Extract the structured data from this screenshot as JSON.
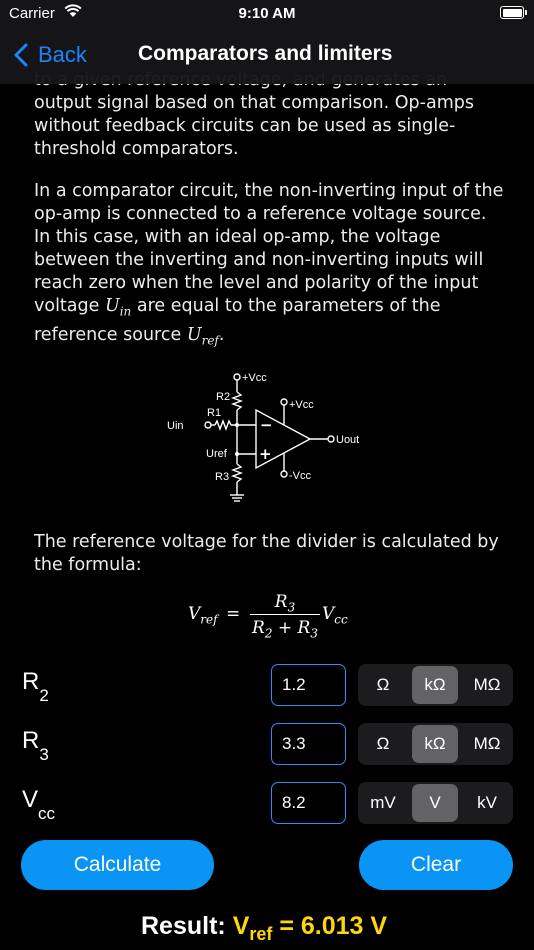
{
  "status_bar": {
    "carrier": "Carrier",
    "time": "9:10 AM"
  },
  "nav": {
    "back_label": "Back",
    "title": "Comparators and limiters"
  },
  "text": {
    "p0_cut": "to a given reference voltage, and generates an",
    "p0": "output signal based on that comparison. Op-amps without feedback circuits can be used as single-threshold comparators.",
    "p1_a": "In a comparator circuit, the non-inverting input of the op-amp is connected to a reference voltage source. In this case, with an ideal op-amp, the voltage between the inverting and non-inverting inputs will reach zero when the level and polarity of the input voltage",
    "p1_b": "are equal to the parameters of the reference source",
    "p2": "The reference voltage for the divider is calculated by the formula:"
  },
  "circuit_labels": {
    "vcc_top": "+Vcc",
    "r2": "R2",
    "r1": "R1",
    "uin": "Uin",
    "vcc_amp": "+Vcc",
    "uout": "Uout",
    "uref": "Uref",
    "minus": "−",
    "plus": "+",
    "r3": "R3",
    "vcc_neg": "-Vcc"
  },
  "formula": {
    "lhs": "V",
    "lhs_sub": "ref",
    "eq": "=",
    "num": "R",
    "num_sub": "3",
    "den_a": "R",
    "den_a_sub": "2",
    "den_plus": " + ",
    "den_b": "R",
    "den_b_sub": "3",
    "rhs": "V",
    "rhs_sub": "cc"
  },
  "math": {
    "uin": "U",
    "uin_sub": "in",
    "uref": "U",
    "uref_sub": "ref"
  },
  "inputs": [
    {
      "label": "R",
      "sub": "2",
      "value": "1.2",
      "units": [
        "Ω",
        "kΩ",
        "MΩ"
      ],
      "selected": 1
    },
    {
      "label": "R",
      "sub": "3",
      "value": "3.3",
      "units": [
        "Ω",
        "kΩ",
        "MΩ"
      ],
      "selected": 1
    },
    {
      "label": "V",
      "sub": "cc",
      "value": "8.2",
      "units": [
        "mV",
        "V",
        "kV"
      ],
      "selected": 1
    }
  ],
  "buttons": {
    "calculate": "Calculate",
    "clear": "Clear"
  },
  "result": {
    "label": "Result:",
    "var": "V",
    "var_sub": "ref",
    "value": "= 6.013 V"
  },
  "colors": {
    "accent": "#1a84ff",
    "button": "#0a95f5",
    "result": "#ffd60a",
    "selected_segment": "#636366"
  }
}
